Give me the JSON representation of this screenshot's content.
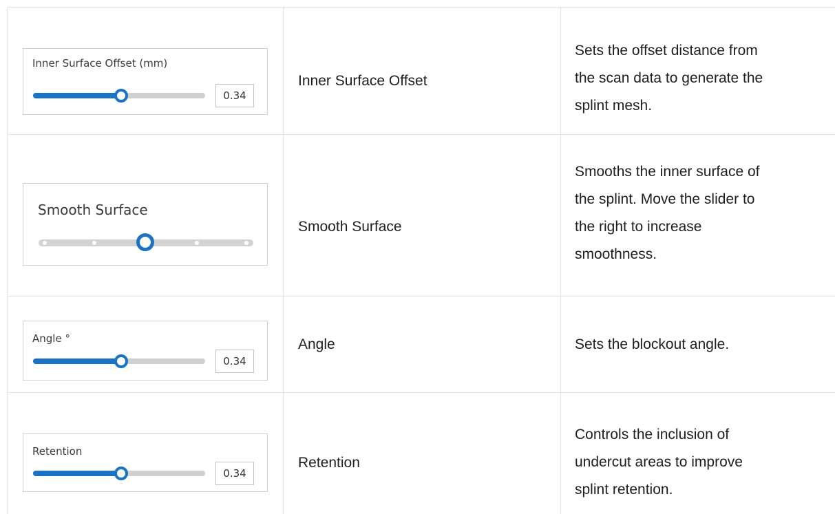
{
  "rows": [
    {
      "widget": {
        "label": "Inner Surface Offset (mm)",
        "value": "0.34",
        "level": 0.5
      },
      "name": "Inner Surface Offset",
      "description": [
        "Sets the offset distance from",
        "the scan data to generate the",
        "splint mesh."
      ]
    },
    {
      "widget": {
        "label": "Smooth Surface",
        "steps": 5,
        "selected_step": 3
      },
      "name": "Smooth Surface",
      "description": [
        "Smooths the inner surface of",
        "the splint. Move the slider to",
        "the right to increase",
        "smoothness."
      ]
    },
    {
      "widget": {
        "label": "Angle °",
        "value": "0.34",
        "level": 0.5
      },
      "name": "Angle",
      "description": [
        "Sets the blockout angle."
      ]
    },
    {
      "widget": {
        "label": "Retention",
        "value": "0.34",
        "level": 0.5
      },
      "name": "Retention",
      "description": [
        "Controls the inclusion of",
        "undercut areas to improve",
        "splint retention."
      ]
    }
  ],
  "colors": {
    "accent": "#1a73c6",
    "track": "#d0d0d0",
    "grid": "#e3e3e3"
  }
}
